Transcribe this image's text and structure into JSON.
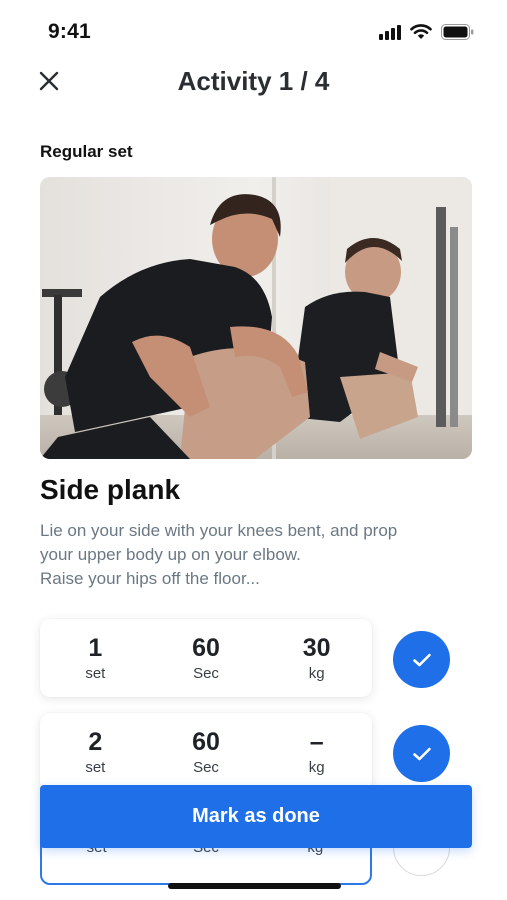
{
  "status_bar": {
    "time": "9:41"
  },
  "header": {
    "title": "Activity 1 / 4"
  },
  "set_type": "Regular set",
  "exercise": {
    "title": "Side plank",
    "description_lines": [
      "Lie on your side with your knees bent, and prop",
      "your upper body up on your elbow.",
      "Raise your hips off the floor..."
    ]
  },
  "sets": [
    {
      "set_value": "1",
      "set_unit": "set",
      "time_value": "60",
      "time_unit": "Sec",
      "weight_value": "30",
      "weight_unit": "kg",
      "done": true
    },
    {
      "set_value": "2",
      "set_unit": "set",
      "time_value": "60",
      "time_unit": "Sec",
      "weight_value": "–",
      "weight_unit": "kg",
      "done": true
    },
    {
      "set_value": "",
      "set_unit": "set",
      "time_value": "",
      "time_unit": "Sec",
      "weight_value": "",
      "weight_unit": "kg",
      "done": false
    }
  ],
  "actions": {
    "mark_done_label": "Mark as done"
  },
  "colors": {
    "accent": "#1f6fe8",
    "description": "#6b7884"
  },
  "icons": {
    "close": "close-icon",
    "check": "check-icon",
    "signal": "cellular-signal-icon",
    "wifi": "wifi-icon",
    "battery": "battery-icon"
  }
}
